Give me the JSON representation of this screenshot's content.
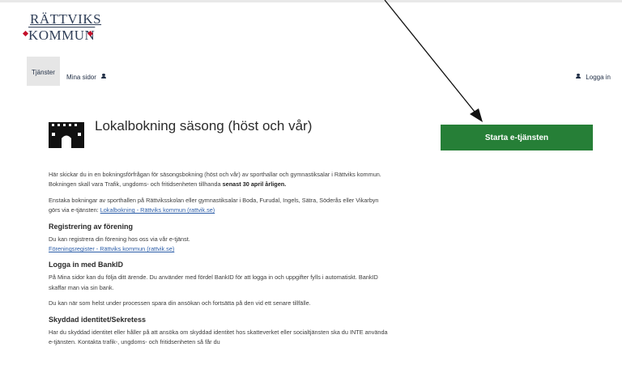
{
  "logo": {
    "line1": "RÄTTVIKS",
    "line2": "KOMMUN"
  },
  "nav": {
    "tab": "Tjänster",
    "mina_sidor": "Mina sidor",
    "login": "Logga in"
  },
  "header": {
    "title": "Lokalbokning säsong (höst och vår)"
  },
  "actions": {
    "start": "Starta e-tjänsten"
  },
  "content": {
    "p1a": "Här skickar du in en bokningsförfrågan för säsongsbokning (höst och vår) av sporthallar och gymnastiksalar i Rättviks kommun. Bokningen skall vara Trafik, ungdoms- och fritidsenheten tillhanda",
    "p1b": "senast 30 april årligen.",
    "p2a": "Enstaka bokningar av sporthallen på Rättviksskolan eller gymnastiksalar i Boda, Furudal, Ingels, Sätra, Söderås eller Vikarbyn görs via e-tjänsten:",
    "p2link": "Lokalbokning - Rättviks kommun (rattvik.se)",
    "h1": "Registrering av förening",
    "p3": "Du kan registrera din förening hos oss via vår e-tjänst.",
    "p3link": "Föreningsregister - Rättviks kommun (rattvik.se)",
    "h2": "Logga in med BankID",
    "p4": "På Mina sidor kan du följa ditt ärende. Du använder med fördel BankID för att logga in och uppgifter fylls i automatiskt.  BankID skaffar man via sin bank.",
    "p5": "Du kan när som helst under processen spara din ansökan och fortsätta på den vid ett senare tillfälle.",
    "h3": "Skyddad identitet/Sekretess",
    "p6": "Har du skyddad identitet eller håller på att ansöka om skyddad identitet hos skatteverket eller socialtjänsten ska du INTE använda e-tjänsten. Kontakta trafik-, ungdoms- och fritidsenheten så får du"
  }
}
